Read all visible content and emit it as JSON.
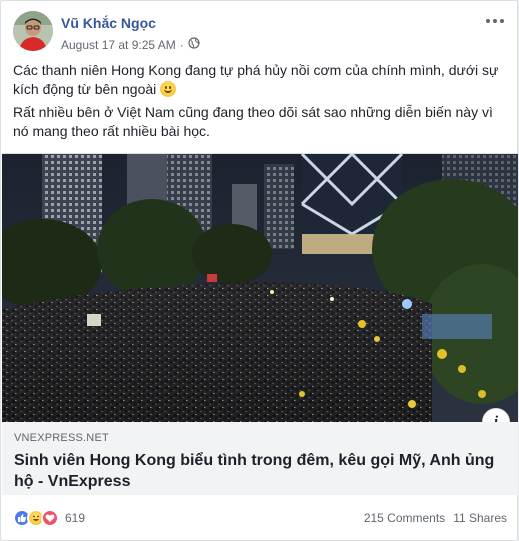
{
  "post": {
    "author": "Vũ Khắc Ngọc",
    "timestamp": "August 17 at 9:25 AM",
    "separator": "·",
    "privacy_icon": "globe-icon",
    "paragraphs": [
      "Các thanh niên Hong Kong đang tự phá hủy nồi cơm của chính mình, dưới sự kích động từ bên ngoài",
      "Rất nhiều bên ở Việt Nam cũng đang theo dõi sát sao những diễn biến này vì nó mang theo rất nhiều bài học."
    ],
    "emoji_icon": "grinning-face-emoji"
  },
  "link": {
    "domain": "VNEXPRESS.NET",
    "title": "Sinh viên Hong Kong biểu tình trong đêm, kêu gọi Mỹ, Anh ủng hộ - VnExpress",
    "info_glyph": "i"
  },
  "footer": {
    "reaction_icons": [
      "like-icon",
      "haha-icon",
      "love-icon"
    ],
    "reaction_count": "619",
    "comments": "215 Comments",
    "shares": "11 Shares"
  },
  "colors": {
    "author": "#365899",
    "like": "#4b7bec",
    "love": "#f25268",
    "link_bg": "#f2f3f5"
  }
}
